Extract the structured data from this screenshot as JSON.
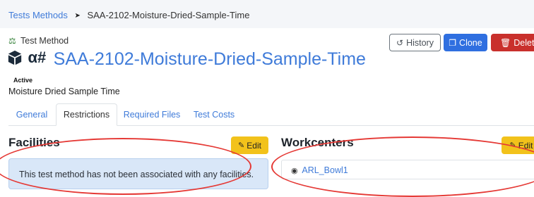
{
  "breadcrumb": {
    "parent": "Tests Methods",
    "separator_icon": "chevron-right-icon",
    "current": "SAA-2102-Moisture-Dried-Sample-Time"
  },
  "header": {
    "subtitle_icon": "scale-icon",
    "subtitle": "Test Method",
    "title_icon": "cube-icon",
    "title_prefix": "α#",
    "title": "SAA-2102-Moisture-Dried-Sample-Time",
    "status": "Active",
    "description": "Moisture Dried Sample Time"
  },
  "actions": {
    "history": "History",
    "clone": "Clone",
    "delete": "Delete"
  },
  "tabs": [
    {
      "label": "General",
      "active": false
    },
    {
      "label": "Restrictions",
      "active": true
    },
    {
      "label": "Required Files",
      "active": false
    },
    {
      "label": "Test Costs",
      "active": false
    }
  ],
  "facilities": {
    "title": "Facilities",
    "edit": "Edit",
    "empty_message": "This test method has not been associated with any facilities."
  },
  "workcenters": {
    "title": "Workcenters",
    "edit": "Edit",
    "items": [
      "ARL_Bowl1"
    ]
  },
  "colors": {
    "link": "#3f7bd9",
    "clone_button": "#2f6fe0",
    "delete_button": "#c9302c",
    "edit_button": "#f2c21b",
    "info_background": "#d9e7f8",
    "annotation": "#e53935"
  }
}
